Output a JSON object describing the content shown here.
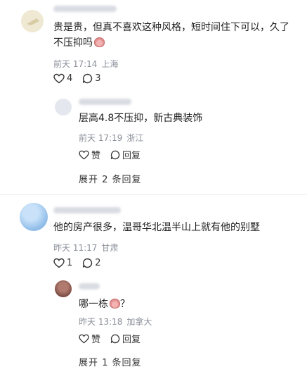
{
  "comments": [
    {
      "text": "贵是贵，但真不喜欢这种风格，短时间住下可以，久了",
      "text_line2": "不压抑吗",
      "time": "前天 17:14",
      "location": "上海",
      "likes": "4",
      "replies_count": "3",
      "reply": {
        "text": "层高4.8不压抑，新古典装饰",
        "time": "前天 17:19",
        "location": "浙江",
        "like_label": "赞",
        "reply_label": "回复"
      },
      "expand_label": "展开 2 条回复"
    },
    {
      "text": "他的房产很多，温哥华北温半山上就有他的别墅",
      "time": "昨天 11:17",
      "location": "甘肃",
      "likes": "1",
      "replies_count": "2",
      "reply": {
        "text": "哪一栋",
        "text_suffix": "？",
        "time": "昨天 13:18",
        "location": "加拿大",
        "like_label": "赞",
        "reply_label": "回复"
      },
      "expand_label": "展开 1 条回复"
    }
  ],
  "colors": {
    "text": "#1f1f1f",
    "meta": "#8a8f99",
    "avatar_1": "#e9e2c8",
    "avatar_2": "#9cc6f0",
    "avatar_reply_2": "#8c5a52"
  }
}
